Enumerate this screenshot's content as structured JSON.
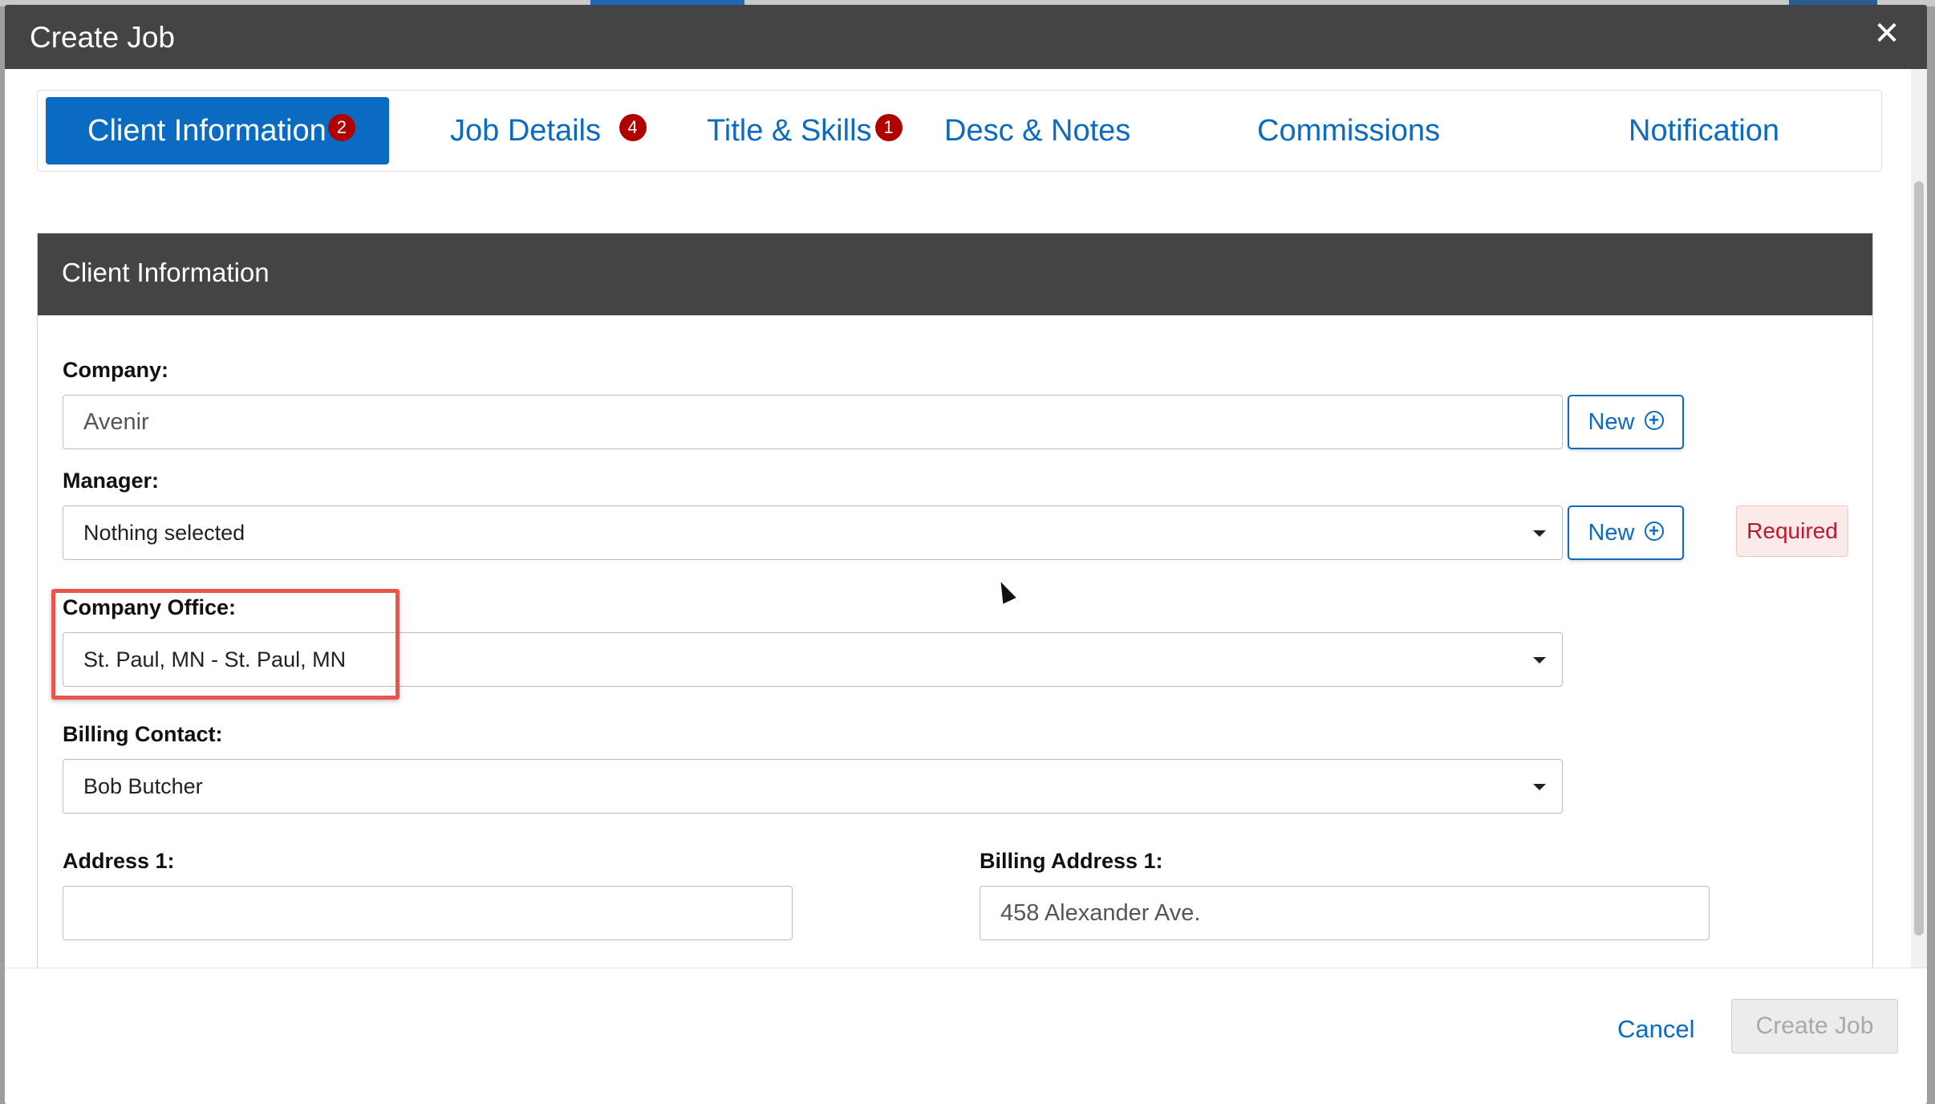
{
  "modal": {
    "title": "Create Job",
    "close_symbol": "✕"
  },
  "tabs": [
    {
      "label": "Client Information",
      "badge": "2",
      "active": true
    },
    {
      "label": "Job Details",
      "badge": "4"
    },
    {
      "label": "Title & Skills",
      "badge": "1"
    },
    {
      "label": "Desc & Notes"
    },
    {
      "label": "Commissions"
    },
    {
      "label": "Notification"
    }
  ],
  "panel": {
    "title": "Client Information"
  },
  "form": {
    "company": {
      "label": "Company:",
      "value": "Avenir",
      "new_label": "New"
    },
    "manager": {
      "label": "Manager:",
      "value": "Nothing selected",
      "new_label": "New",
      "required_label": "Required"
    },
    "company_office": {
      "label": "Company Office:",
      "value": "St. Paul, MN - St. Paul, MN"
    },
    "billing_contact": {
      "label": "Billing Contact:",
      "value": "Bob Butcher"
    },
    "address1": {
      "label": "Address 1:",
      "value": ""
    },
    "billing_address1": {
      "label": "Billing Address 1:",
      "value": "458 Alexander Ave."
    }
  },
  "footer": {
    "cancel_label": "Cancel",
    "create_label": "Create Job"
  },
  "colors": {
    "accent": "#0b6bc2",
    "header": "#444444",
    "badge": "#b00000",
    "required": "#c0182b",
    "highlight": "#e8564b"
  },
  "icons": {
    "plus": "plus-circle-icon",
    "caret": "caret-down-icon",
    "close": "close-icon"
  }
}
